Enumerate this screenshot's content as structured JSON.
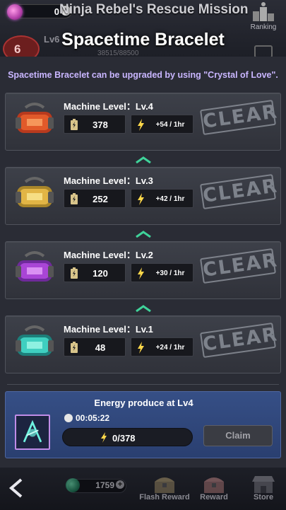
{
  "topbar": {
    "gems": "0",
    "gem_plus": "+",
    "mission_title": "Ninja Rebel's Rescue Mission",
    "ranking_label": "Ranking",
    "level_badge": "6",
    "level_text": "Lv6",
    "xp_text": "38515/88500"
  },
  "popup": {
    "title": "Spacetime Bracelet",
    "subtitle": "Spacetime Bracelet can be upgraded by using \"Crystal of Love\".",
    "machines": [
      {
        "label": "Machine Level：Lv.4",
        "capacity": "378",
        "rate": "+54 / 1hr",
        "status": "CLEAR",
        "color": "red"
      },
      {
        "label": "Machine Level：Lv.3",
        "capacity": "252",
        "rate": "+42 / 1hr",
        "status": "CLEAR",
        "color": "gold"
      },
      {
        "label": "Machine Level：Lv.2",
        "capacity": "120",
        "rate": "+30 / 1hr",
        "status": "CLEAR",
        "color": "purple"
      },
      {
        "label": "Machine Level：Lv.1",
        "capacity": "48",
        "rate": "+24 / 1hr",
        "status": "CLEAR",
        "color": "teal"
      }
    ],
    "energy": {
      "title": "Energy produce at Lv4",
      "timer": "00:05:22",
      "progress_text": "0/378",
      "progress_fraction": 0,
      "claim_label": "Claim"
    }
  },
  "bottombar": {
    "coins": "1759",
    "coin_plus": "+",
    "nav": [
      {
        "label": "Flash Reward",
        "icon": "treasure-chest-icon"
      },
      {
        "label": "Reward",
        "icon": "reward-chest-icon"
      },
      {
        "label": "Store",
        "icon": "store-icon"
      }
    ]
  },
  "colors": {
    "accent_text": "#c9b6ff",
    "energy_panel": "#364f86",
    "clear_stamp": "#8a8f98",
    "chevron": "#3fd39a"
  }
}
